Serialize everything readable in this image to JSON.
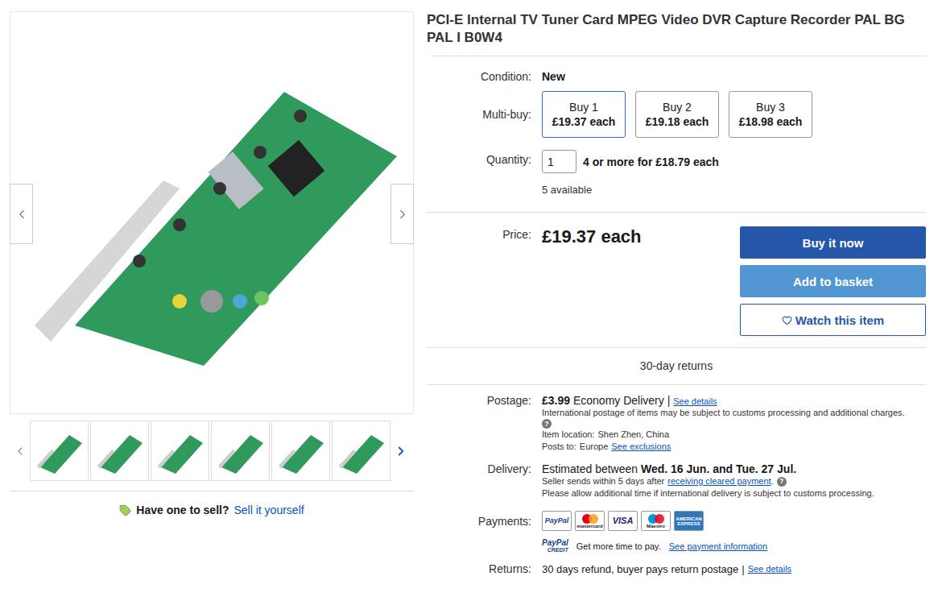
{
  "title": "PCI-E Internal TV Tuner Card MPEG Video DVR Capture Recorder PAL BG PAL I B0W4",
  "gallery": {
    "thumbnails": [
      {
        "selected": false
      },
      {
        "selected": false
      },
      {
        "selected": false
      },
      {
        "selected": false
      },
      {
        "selected": false
      },
      {
        "selected": false
      }
    ]
  },
  "sell": {
    "prompt": "Have one to sell?",
    "link": "Sell it yourself"
  },
  "condition": {
    "label": "Condition:",
    "value": "New"
  },
  "multibuy": {
    "label": "Multi-buy:",
    "options": [
      {
        "title": "Buy 1",
        "price": "£19.37 each",
        "selected": true
      },
      {
        "title": "Buy 2",
        "price": "£19.18 each",
        "selected": false
      },
      {
        "title": "Buy 3",
        "price": "£18.98 each",
        "selected": false
      }
    ]
  },
  "quantity": {
    "label": "Quantity:",
    "value": "1",
    "offer": "4 or more for £18.79 each",
    "available": "5 available"
  },
  "price": {
    "label": "Price:",
    "value": "£19.37 each"
  },
  "buttons": [
    {
      "label": "Buy it now",
      "kind": "primary"
    },
    {
      "label": "Add to basket",
      "kind": "secondary"
    },
    {
      "label": "Watch this item",
      "kind": "outline"
    }
  ],
  "returns_banner": "30-day returns",
  "postage": {
    "label": "Postage:",
    "price": "£3.99",
    "service": "Economy Delivery",
    "separator": "|",
    "link": "See details",
    "note": "International postage of items may be subject to customs processing and additional charges.",
    "help": "?",
    "location_label": "Item location:",
    "location": "Shen Zhen, China",
    "posts_label": "Posts to:",
    "posts_to": "Europe",
    "exclusions": "See exclusions"
  },
  "delivery": {
    "label": "Delivery:",
    "prefix": "Estimated between",
    "estimate": "Wed. 16 Jun. and Tue. 27 Jul.",
    "dispatch": "Seller sends within 5 days after",
    "dispatch_link": "receiving cleared payment",
    "dispatch_end": ".",
    "help": "?",
    "note": "Please allow additional time if international delivery is subject to customs processing."
  },
  "payments": {
    "label": "Payments:",
    "cards": [
      "PayPal",
      "mastercard",
      "VISA",
      "Maestro",
      "AMERICAN EXPRESS"
    ]
  },
  "credit": {
    "logo_top": "PayPal",
    "logo_bottom": "CREDIT",
    "text": "Get more time to pay.",
    "link": "See payment information"
  },
  "returns": {
    "label": "Returns:",
    "text": "30 days refund, buyer pays return postage",
    "separator": "|",
    "link": "See details"
  }
}
